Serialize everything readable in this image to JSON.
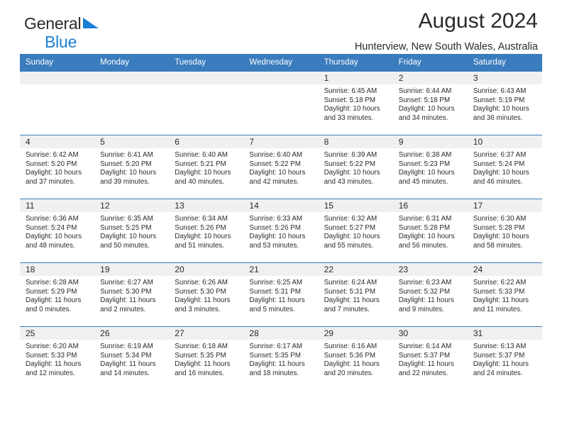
{
  "brand": {
    "line1": "General",
    "line2": "Blue",
    "triangle_color": "#1b7fd4"
  },
  "header": {
    "title": "August 2024",
    "subtitle": "Hunterview, New South Wales, Australia"
  },
  "theme": {
    "header_blue": "#3a7cbd",
    "daynum_bg": "#f0f0f0",
    "text": "#2b2b2b"
  },
  "labels": {
    "sunrise": "Sunrise:",
    "sunset": "Sunset:",
    "daylight": "Daylight:"
  },
  "weekdays": [
    "Sunday",
    "Monday",
    "Tuesday",
    "Wednesday",
    "Thursday",
    "Friday",
    "Saturday"
  ],
  "weeks": [
    [
      {
        "day": "",
        "empty": true
      },
      {
        "day": "",
        "empty": true
      },
      {
        "day": "",
        "empty": true
      },
      {
        "day": "",
        "empty": true
      },
      {
        "day": "1",
        "sunrise": "Sunrise: 6:45 AM",
        "sunset": "Sunset: 5:18 PM",
        "daylight": "Daylight: 10 hours and 33 minutes."
      },
      {
        "day": "2",
        "sunrise": "Sunrise: 6:44 AM",
        "sunset": "Sunset: 5:18 PM",
        "daylight": "Daylight: 10 hours and 34 minutes."
      },
      {
        "day": "3",
        "sunrise": "Sunrise: 6:43 AM",
        "sunset": "Sunset: 5:19 PM",
        "daylight": "Daylight: 10 hours and 36 minutes."
      }
    ],
    [
      {
        "day": "4",
        "sunrise": "Sunrise: 6:42 AM",
        "sunset": "Sunset: 5:20 PM",
        "daylight": "Daylight: 10 hours and 37 minutes."
      },
      {
        "day": "5",
        "sunrise": "Sunrise: 6:41 AM",
        "sunset": "Sunset: 5:20 PM",
        "daylight": "Daylight: 10 hours and 39 minutes."
      },
      {
        "day": "6",
        "sunrise": "Sunrise: 6:40 AM",
        "sunset": "Sunset: 5:21 PM",
        "daylight": "Daylight: 10 hours and 40 minutes."
      },
      {
        "day": "7",
        "sunrise": "Sunrise: 6:40 AM",
        "sunset": "Sunset: 5:22 PM",
        "daylight": "Daylight: 10 hours and 42 minutes."
      },
      {
        "day": "8",
        "sunrise": "Sunrise: 6:39 AM",
        "sunset": "Sunset: 5:22 PM",
        "daylight": "Daylight: 10 hours and 43 minutes."
      },
      {
        "day": "9",
        "sunrise": "Sunrise: 6:38 AM",
        "sunset": "Sunset: 5:23 PM",
        "daylight": "Daylight: 10 hours and 45 minutes."
      },
      {
        "day": "10",
        "sunrise": "Sunrise: 6:37 AM",
        "sunset": "Sunset: 5:24 PM",
        "daylight": "Daylight: 10 hours and 46 minutes."
      }
    ],
    [
      {
        "day": "11",
        "sunrise": "Sunrise: 6:36 AM",
        "sunset": "Sunset: 5:24 PM",
        "daylight": "Daylight: 10 hours and 48 minutes."
      },
      {
        "day": "12",
        "sunrise": "Sunrise: 6:35 AM",
        "sunset": "Sunset: 5:25 PM",
        "daylight": "Daylight: 10 hours and 50 minutes."
      },
      {
        "day": "13",
        "sunrise": "Sunrise: 6:34 AM",
        "sunset": "Sunset: 5:26 PM",
        "daylight": "Daylight: 10 hours and 51 minutes."
      },
      {
        "day": "14",
        "sunrise": "Sunrise: 6:33 AM",
        "sunset": "Sunset: 5:26 PM",
        "daylight": "Daylight: 10 hours and 53 minutes."
      },
      {
        "day": "15",
        "sunrise": "Sunrise: 6:32 AM",
        "sunset": "Sunset: 5:27 PM",
        "daylight": "Daylight: 10 hours and 55 minutes."
      },
      {
        "day": "16",
        "sunrise": "Sunrise: 6:31 AM",
        "sunset": "Sunset: 5:28 PM",
        "daylight": "Daylight: 10 hours and 56 minutes."
      },
      {
        "day": "17",
        "sunrise": "Sunrise: 6:30 AM",
        "sunset": "Sunset: 5:28 PM",
        "daylight": "Daylight: 10 hours and 58 minutes."
      }
    ],
    [
      {
        "day": "18",
        "sunrise": "Sunrise: 6:28 AM",
        "sunset": "Sunset: 5:29 PM",
        "daylight": "Daylight: 11 hours and 0 minutes."
      },
      {
        "day": "19",
        "sunrise": "Sunrise: 6:27 AM",
        "sunset": "Sunset: 5:30 PM",
        "daylight": "Daylight: 11 hours and 2 minutes."
      },
      {
        "day": "20",
        "sunrise": "Sunrise: 6:26 AM",
        "sunset": "Sunset: 5:30 PM",
        "daylight": "Daylight: 11 hours and 3 minutes."
      },
      {
        "day": "21",
        "sunrise": "Sunrise: 6:25 AM",
        "sunset": "Sunset: 5:31 PM",
        "daylight": "Daylight: 11 hours and 5 minutes."
      },
      {
        "day": "22",
        "sunrise": "Sunrise: 6:24 AM",
        "sunset": "Sunset: 5:31 PM",
        "daylight": "Daylight: 11 hours and 7 minutes."
      },
      {
        "day": "23",
        "sunrise": "Sunrise: 6:23 AM",
        "sunset": "Sunset: 5:32 PM",
        "daylight": "Daylight: 11 hours and 9 minutes."
      },
      {
        "day": "24",
        "sunrise": "Sunrise: 6:22 AM",
        "sunset": "Sunset: 5:33 PM",
        "daylight": "Daylight: 11 hours and 11 minutes."
      }
    ],
    [
      {
        "day": "25",
        "sunrise": "Sunrise: 6:20 AM",
        "sunset": "Sunset: 5:33 PM",
        "daylight": "Daylight: 11 hours and 12 minutes."
      },
      {
        "day": "26",
        "sunrise": "Sunrise: 6:19 AM",
        "sunset": "Sunset: 5:34 PM",
        "daylight": "Daylight: 11 hours and 14 minutes."
      },
      {
        "day": "27",
        "sunrise": "Sunrise: 6:18 AM",
        "sunset": "Sunset: 5:35 PM",
        "daylight": "Daylight: 11 hours and 16 minutes."
      },
      {
        "day": "28",
        "sunrise": "Sunrise: 6:17 AM",
        "sunset": "Sunset: 5:35 PM",
        "daylight": "Daylight: 11 hours and 18 minutes."
      },
      {
        "day": "29",
        "sunrise": "Sunrise: 6:16 AM",
        "sunset": "Sunset: 5:36 PM",
        "daylight": "Daylight: 11 hours and 20 minutes."
      },
      {
        "day": "30",
        "sunrise": "Sunrise: 6:14 AM",
        "sunset": "Sunset: 5:37 PM",
        "daylight": "Daylight: 11 hours and 22 minutes."
      },
      {
        "day": "31",
        "sunrise": "Sunrise: 6:13 AM",
        "sunset": "Sunset: 5:37 PM",
        "daylight": "Daylight: 11 hours and 24 minutes."
      }
    ]
  ]
}
